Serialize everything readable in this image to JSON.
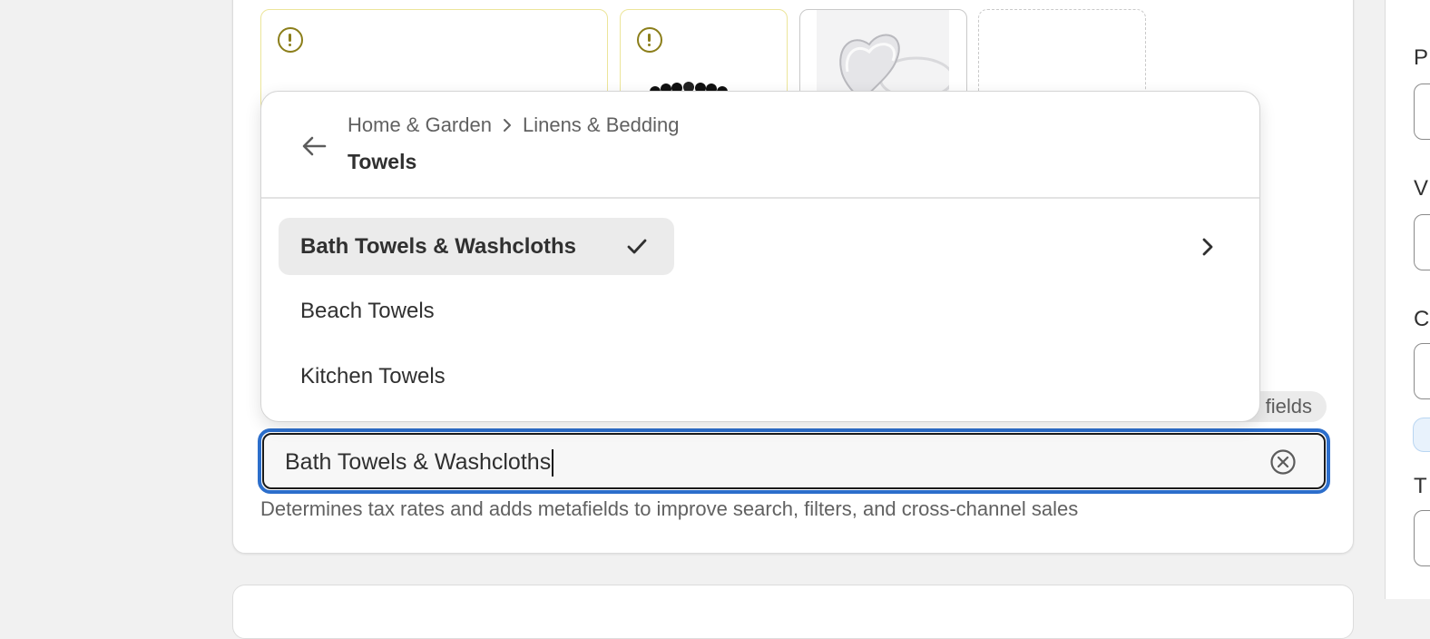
{
  "category_picker": {
    "breadcrumb": [
      "Home & Garden",
      "Linens & Bedding"
    ],
    "current_title": "Towels",
    "options": [
      {
        "label": "Bath Towels & Washcloths",
        "selected": true,
        "has_children": true
      },
      {
        "label": "Beach Towels",
        "selected": false,
        "has_children": false
      },
      {
        "label": "Kitchen Towels",
        "selected": false,
        "has_children": false
      }
    ]
  },
  "category_field": {
    "value": "Bath Towels & Washcloths",
    "help_text": "Determines tax rates and adds metafields to improve search, filters, and cross-channel sales"
  },
  "partially_hidden": {
    "metafields_chip": "fields",
    "right_panel_labels": [
      "P",
      "V",
      "C",
      "T"
    ]
  },
  "icons": {
    "back": "arrow-left-icon",
    "breadcrumb_separator": "chevron-right-icon",
    "selected": "checkmark-icon",
    "drill_down": "chevron-right-icon",
    "clear": "circle-x-icon",
    "media_warning": "alert-circle-icon"
  },
  "colors": {
    "focus_ring": "#2c6ecb",
    "warning": "#8b7e1a",
    "selected_bg": "#ebebeb"
  }
}
